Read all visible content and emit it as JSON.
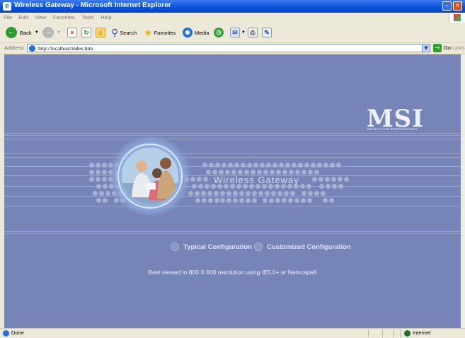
{
  "window": {
    "title": "Wireless Gateway - Microsoft Internet Explorer",
    "minimize": "–",
    "close": "×"
  },
  "menu": [
    "File",
    "Edit",
    "View",
    "Favorites",
    "Tools",
    "Help"
  ],
  "toolbar": {
    "back": "Back",
    "search": "Search",
    "favorites": "Favorites",
    "media": "Media"
  },
  "address": {
    "label": "Address",
    "url": "http://localhost/index.htm",
    "go": "Go",
    "links": "Links"
  },
  "page": {
    "logo": "MSI",
    "logo_sub": "MICRO STAR INTERNATIONAL",
    "product": "Wireless Gateway",
    "typical": "Typical Configuration",
    "customized": "Customized Configuration",
    "note": "Best viewed in 800 X 600 resolution using IE5.0+ or Netscape6",
    "bg_color": "#7784b7"
  },
  "status": {
    "text": "Done",
    "zone": "Internet"
  }
}
